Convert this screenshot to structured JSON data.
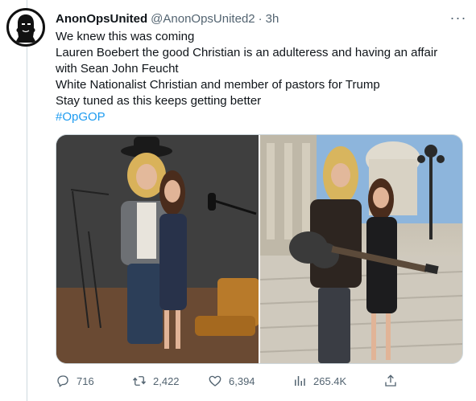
{
  "tweet": {
    "author_name": "AnonOpsUnited",
    "handle": "@AnonOpsUnited2",
    "separator": "·",
    "time": "3h",
    "more_label": "···",
    "lines": [
      "We knew this was coming",
      "Lauren Boebert the good Christian is an adulteress and having an affair",
      "with Sean John Feucht",
      "White Nationalist Christian and member of pastors for Trump",
      "Stay tuned as this keeps getting better"
    ],
    "hashtag": "#OpGOP"
  },
  "media": {
    "photos": [
      {
        "subject": "studio-photo"
      },
      {
        "subject": "capitol-steps-photo"
      }
    ]
  },
  "actions": {
    "replies": "716",
    "retweets": "2,422",
    "likes": "6,394",
    "views": "265.4K"
  },
  "colors": {
    "text": "#0f1419",
    "secondary": "#536471",
    "link": "#1d9bf0",
    "border": "#cfd9de"
  },
  "icons": {
    "avatar": "anonymous-mask-icon",
    "reply": "reply-icon",
    "retweet": "retweet-icon",
    "like": "heart-icon",
    "views": "views-icon",
    "share": "share-icon",
    "more": "more-options-icon"
  }
}
